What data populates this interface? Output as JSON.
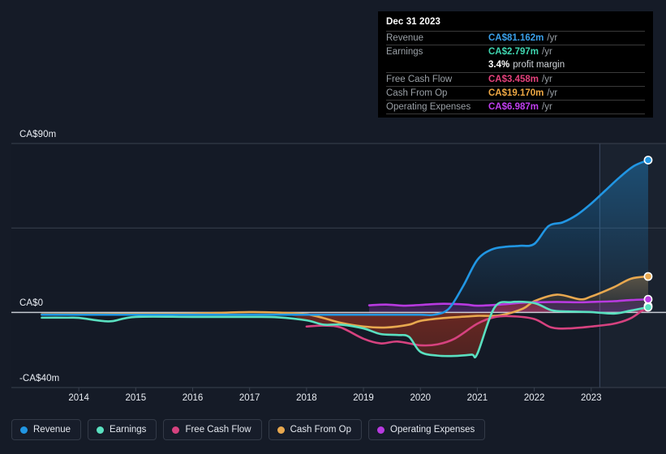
{
  "chart_data": {
    "type": "line",
    "title": "",
    "xlabel": "",
    "ylabel": "",
    "currency": "CA$",
    "units": "m",
    "ylim": [
      -40,
      90
    ],
    "grid": true,
    "legend_position": "bottom",
    "y_ticks": [
      {
        "value": 90,
        "label": "CA$90m"
      },
      {
        "value": 0,
        "label": "CA$0"
      },
      {
        "value": -40,
        "label": "-CA$40m"
      }
    ],
    "x_ticks": [
      "2014",
      "2015",
      "2016",
      "2017",
      "2018",
      "2019",
      "2020",
      "2021",
      "2022",
      "2023"
    ],
    "x_range": [
      2013.3,
      2024.1
    ],
    "series": [
      {
        "name": "Revenue",
        "color": "#2196e3",
        "end_value": 81.162,
        "x": [
          2013.35,
          2014.0,
          2015.0,
          2016.0,
          2017.0,
          2018.0,
          2018.5,
          2019.0,
          2019.5,
          2020.0,
          2020.25,
          2020.5,
          2020.75,
          2021.0,
          2021.25,
          2021.5,
          2021.75,
          2022.0,
          2022.25,
          2022.5,
          2022.75,
          2023.0,
          2023.25,
          2023.5,
          2023.75,
          2024.0
        ],
        "values": [
          -1.2,
          -1.2,
          -1.2,
          -1.2,
          -1.2,
          -1.2,
          -1.2,
          -1.2,
          -1.2,
          -1.2,
          -1.2,
          2.0,
          14.0,
          28.0,
          33.5,
          35.0,
          35.5,
          36.5,
          46.0,
          48.0,
          52.0,
          58.0,
          65.0,
          72.0,
          78.0,
          81.162
        ]
      },
      {
        "name": "Earnings",
        "color": "#5ae0c0",
        "end_value": 2.797,
        "profit_margin": "3.4%",
        "x": [
          2013.35,
          2013.8,
          2014.0,
          2014.4,
          2014.6,
          2015.0,
          2016.0,
          2017.0,
          2017.5,
          2018.0,
          2018.3,
          2018.6,
          2019.0,
          2019.3,
          2019.6,
          2019.8,
          2020.0,
          2020.3,
          2020.6,
          2020.9,
          2021.0,
          2021.3,
          2021.6,
          2022.0,
          2022.3,
          2022.6,
          2023.0,
          2023.4,
          2023.7,
          2024.0
        ],
        "values": [
          -2.8,
          -2.8,
          -2.9,
          -4.5,
          -4.6,
          -2.4,
          -2.4,
          -2.4,
          -2.6,
          -4.2,
          -6.5,
          -6.5,
          -8.5,
          -11.5,
          -12.0,
          -13.0,
          -21.0,
          -23.0,
          -23.2,
          -22.5,
          -22.0,
          2.5,
          5.5,
          5.0,
          1.2,
          0.5,
          0.2,
          -0.6,
          1.0,
          2.797
        ]
      },
      {
        "name": "Free Cash Flow",
        "color": "#d6427f",
        "end_value": 3.458,
        "x": [
          2018.0,
          2018.3,
          2018.6,
          2019.0,
          2019.3,
          2019.6,
          2020.0,
          2020.3,
          2020.6,
          2021.0,
          2021.3,
          2021.6,
          2022.0,
          2022.3,
          2022.6,
          2023.0,
          2023.4,
          2023.7,
          2024.0
        ],
        "values": [
          -7.5,
          -7.0,
          -8.0,
          -14.0,
          -16.5,
          -15.5,
          -17.5,
          -17.0,
          -14.0,
          -6.0,
          -2.5,
          -2.0,
          -3.5,
          -8.0,
          -8.5,
          -7.5,
          -6.0,
          -3.0,
          3.458
        ]
      },
      {
        "name": "Cash From Op",
        "color": "#e8a84f",
        "end_value": 19.17,
        "x": [
          2013.35,
          2014.0,
          2015.0,
          2016.0,
          2017.0,
          2017.6,
          2018.0,
          2018.3,
          2018.6,
          2019.0,
          2019.4,
          2019.8,
          2020.0,
          2020.4,
          2020.8,
          2021.0,
          2021.4,
          2021.8,
          2022.0,
          2022.4,
          2022.8,
          2023.0,
          2023.4,
          2023.7,
          2024.0
        ],
        "values": [
          -1.0,
          -0.9,
          -0.8,
          -0.6,
          0.2,
          -0.2,
          -1.0,
          -3.0,
          -5.5,
          -7.5,
          -8.0,
          -6.5,
          -4.5,
          -3.0,
          -2.2,
          -1.8,
          -1.5,
          2.0,
          6.0,
          9.5,
          7.0,
          8.5,
          13.5,
          18.0,
          19.17
        ]
      },
      {
        "name": "Operating Expenses",
        "color": "#b83ae0",
        "end_value": 6.987,
        "x": [
          2019.1,
          2019.4,
          2019.7,
          2020.0,
          2020.4,
          2020.8,
          2021.0,
          2021.4,
          2021.8,
          2022.0,
          2022.4,
          2022.8,
          2023.0,
          2023.4,
          2023.7,
          2024.0
        ],
        "values": [
          3.8,
          4.2,
          3.6,
          4.0,
          4.6,
          4.2,
          3.6,
          4.2,
          5.2,
          5.4,
          5.6,
          5.4,
          5.6,
          6.0,
          6.6,
          6.987
        ]
      }
    ],
    "forecast_divider_year": 2023.15,
    "zero_line_color": "#d8dde4"
  },
  "tooltip": {
    "title": "Dec 31 2023",
    "unit_suffix": "/yr",
    "rows": [
      {
        "label": "Revenue",
        "value": "CA$81.162m",
        "color": "#3aa0ea",
        "unit": "/yr"
      },
      {
        "label": "Earnings",
        "value": "CA$2.797m",
        "color": "#3fd6b0",
        "unit": "/yr"
      },
      {
        "label": "",
        "value": "3.4%",
        "color": "#ffffff",
        "sub": "profit margin"
      },
      {
        "label": "Free Cash Flow",
        "value": "CA$3.458m",
        "color": "#e5417c",
        "unit": "/yr"
      },
      {
        "label": "Cash From Op",
        "value": "CA$19.170m",
        "color": "#f0a944",
        "unit": "/yr"
      },
      {
        "label": "Operating Expenses",
        "value": "CA$6.987m",
        "color": "#c03ff0",
        "unit": "/yr"
      }
    ]
  },
  "legend": {
    "items": [
      {
        "label": "Revenue",
        "color": "#2196e3"
      },
      {
        "label": "Earnings",
        "color": "#5ae0c0"
      },
      {
        "label": "Free Cash Flow",
        "color": "#d6427f"
      },
      {
        "label": "Cash From Op",
        "color": "#e8a84f"
      },
      {
        "label": "Operating Expenses",
        "color": "#b83ae0"
      }
    ]
  }
}
